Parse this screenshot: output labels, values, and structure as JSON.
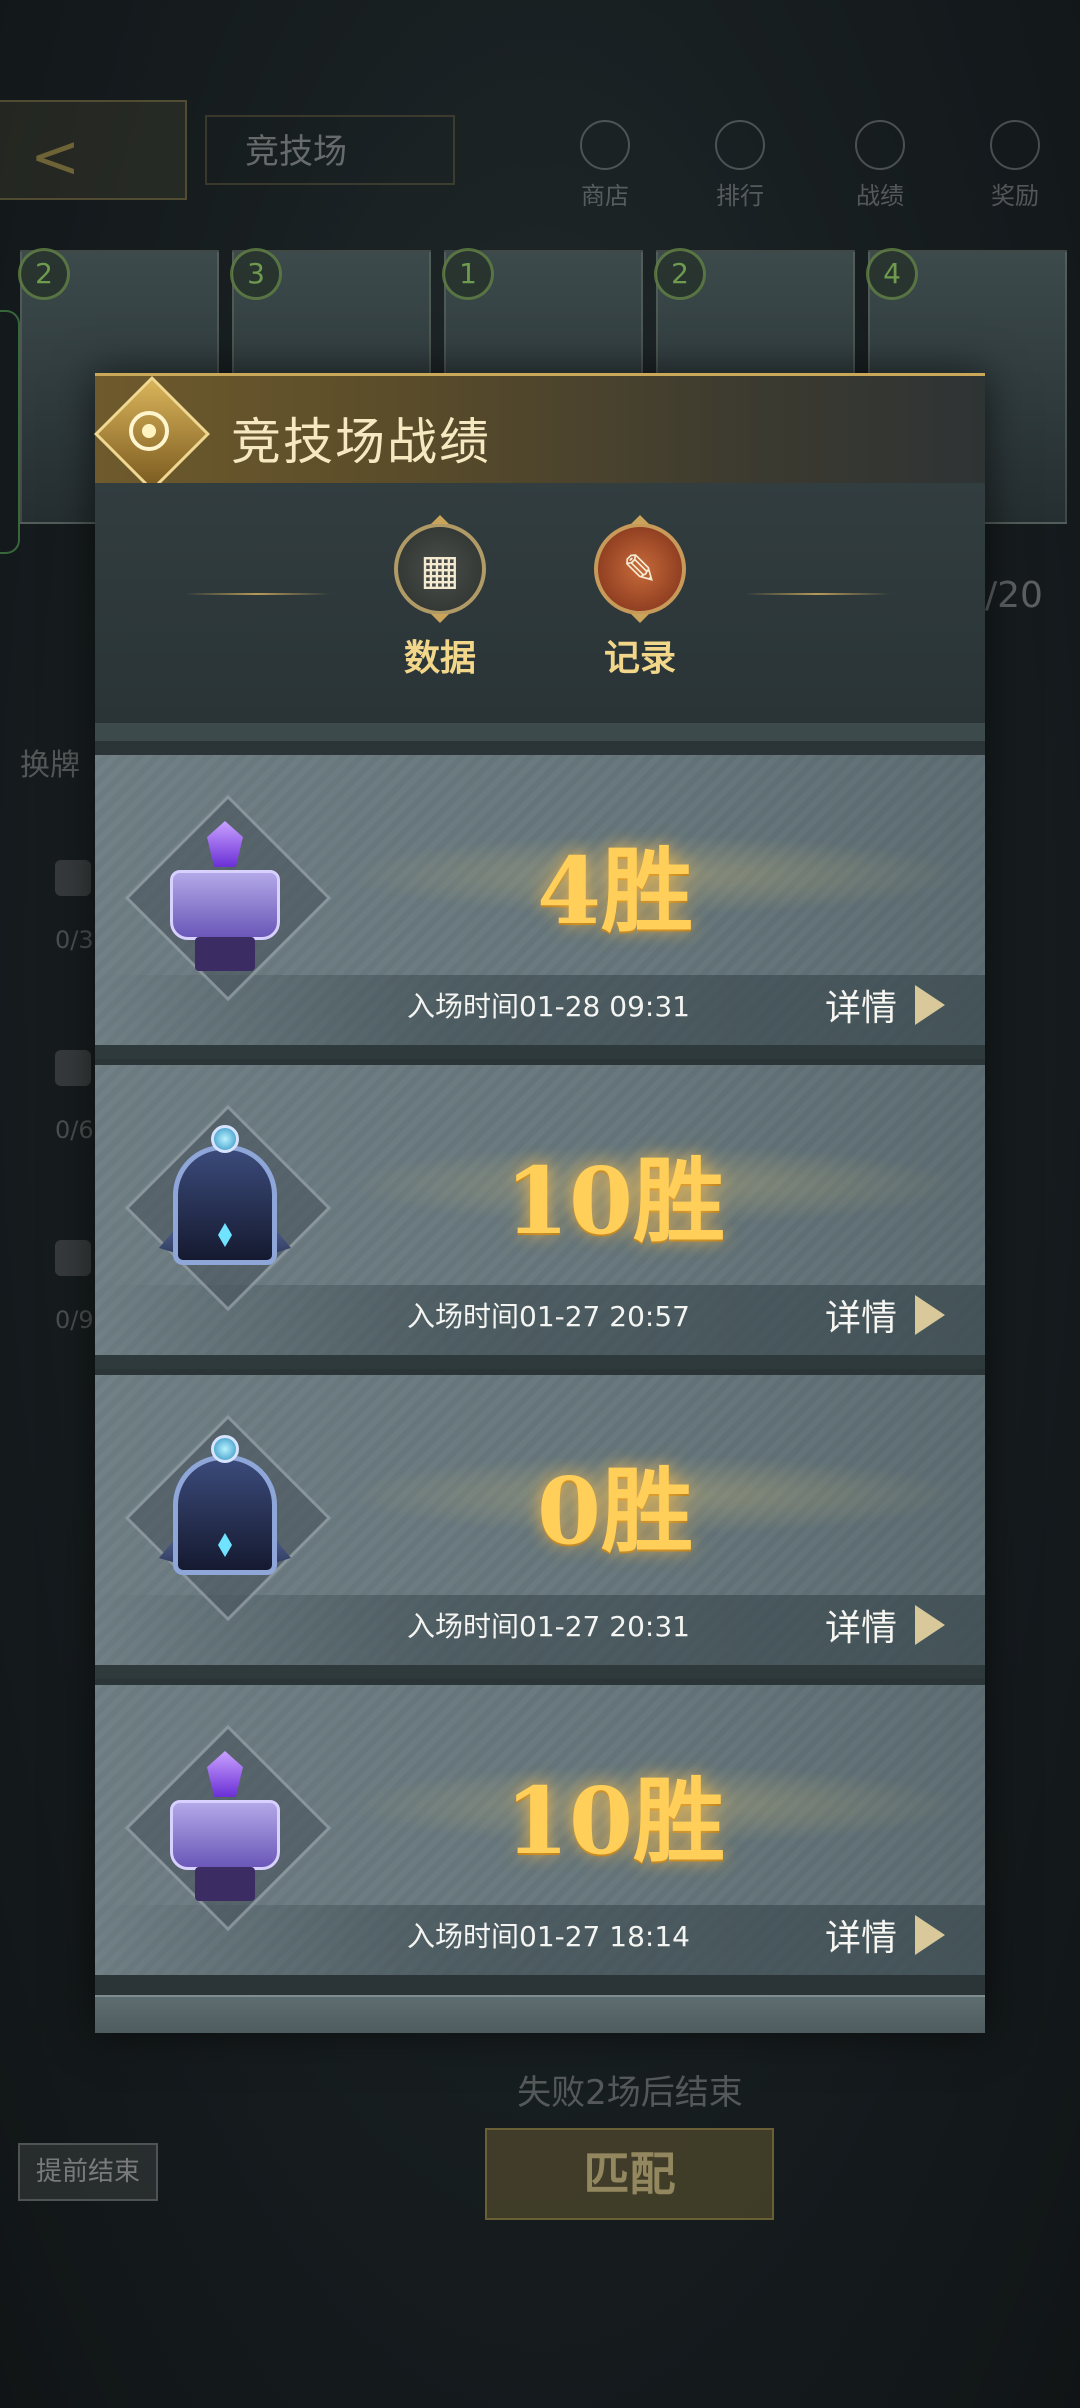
{
  "background": {
    "back_arrow": "<",
    "title": "竞技场",
    "nav": [
      {
        "label": "商店"
      },
      {
        "label": "排行"
      },
      {
        "label": "战绩"
      },
      {
        "label": "奖励"
      }
    ],
    "cards": [
      {
        "num": "2"
      },
      {
        "num": "3"
      },
      {
        "num": "1"
      },
      {
        "num": "2"
      },
      {
        "num": "4"
      }
    ],
    "count": "/20",
    "left_label": "换牌",
    "locks": [
      "0/3",
      "0/6",
      "0/9"
    ],
    "footer_text": "失败2场后结束",
    "end_button": "提前结束",
    "match_button": "匹配"
  },
  "modal": {
    "title": "竞技场战绩",
    "tabs": [
      {
        "label": "数据",
        "icon": "data-chart-icon"
      },
      {
        "label": "记录",
        "icon": "record-quill-icon",
        "selected": true
      }
    ],
    "records": [
      {
        "wins": "4胜",
        "time": "入场时间01-28 09:31",
        "detail": "详情",
        "emblem": "book"
      },
      {
        "wins": "10胜",
        "time": "入场时间01-27 20:57",
        "detail": "详情",
        "emblem": "arch"
      },
      {
        "wins": "0胜",
        "time": "入场时间01-27 20:31",
        "detail": "详情",
        "emblem": "arch"
      },
      {
        "wins": "10胜",
        "time": "入场时间01-27 18:14",
        "detail": "详情",
        "emblem": "book"
      }
    ]
  },
  "colors": {
    "accent_gold": "#ffcf5a",
    "tab_label": "#f2d68a",
    "header_gold": "#6e5a2c"
  }
}
